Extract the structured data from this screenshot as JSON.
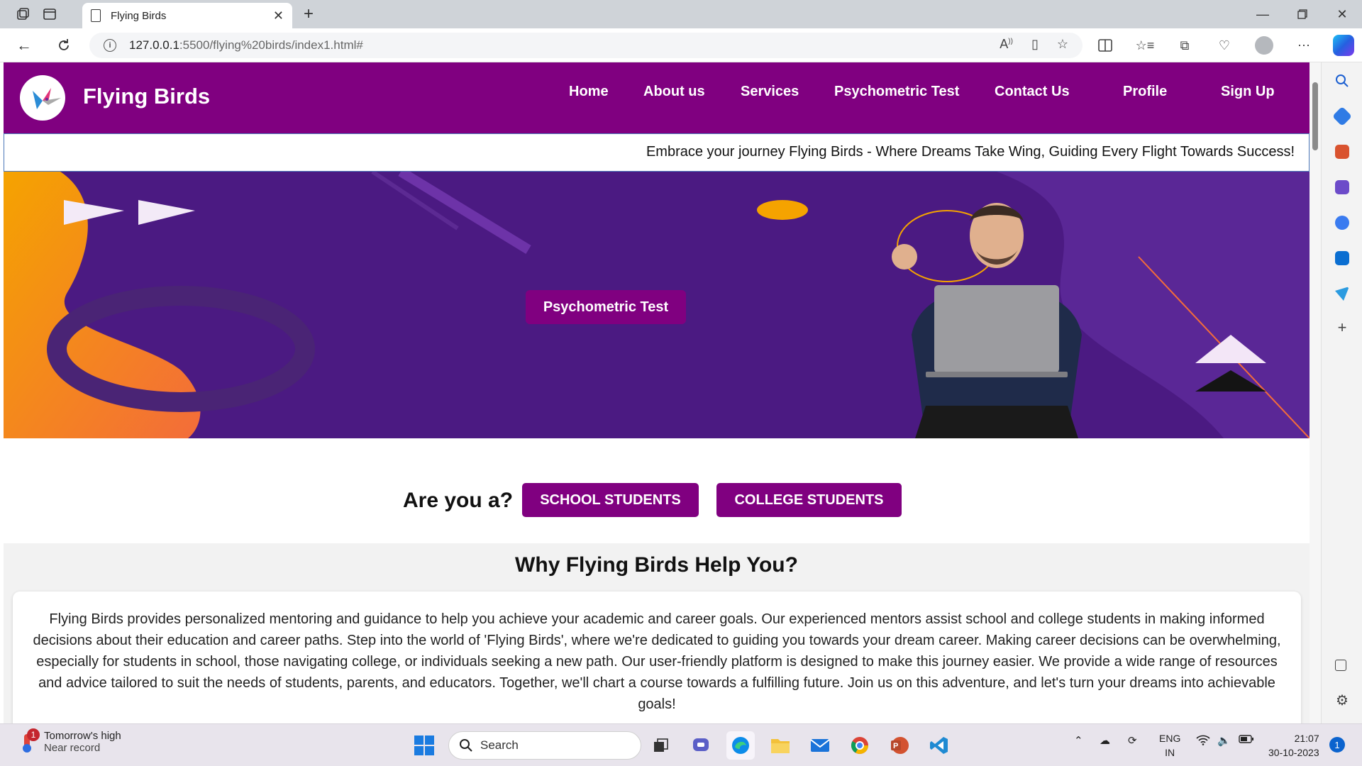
{
  "browser": {
    "tab_title": "Flying Birds",
    "new_tab_symbol": "+",
    "address_host": "127.0.0.1",
    "address_path": ":5500/flying%20birds/index1.html#"
  },
  "site": {
    "brand": "Flying Birds",
    "nav": [
      "Home",
      "About us",
      "Services",
      "Psychometric Test",
      "Contact Us",
      "Profile",
      "Sign Up"
    ],
    "marquee": "Embrace your journey Flying Birds - Where Dreams Take Wing, Guiding Every Flight Towards Success!",
    "hero_button": "Psychometric Test",
    "question": "Are you a?",
    "school_button": "SCHOOL STUDENTS",
    "college_button": "COLLEGE STUDENTS",
    "why_title": "Why Flying Birds Help You?",
    "why_text": "Flying Birds provides personalized mentoring and guidance to help you achieve your academic and career goals. Our experienced mentors assist school and college students in making informed decisions about their education and career paths. Step into the world of 'Flying Birds', where we're dedicated to guiding you towards your dream career. Making career decisions can be overwhelming, especially for students in school, those navigating college, or individuals seeking a new path. Our user-friendly platform is designed to make this journey easier. We provide a wide range of resources and advice tailored to suit the needs of students, parents, and educators. Together, we'll chart a course towards a fulfilling future. Join us on this adventure, and let's turn your dreams into achievable goals!",
    "colors": {
      "primary": "#800080",
      "hero_bg": "#4b1a82",
      "accent_orange": "#f5a300"
    }
  },
  "taskbar": {
    "weather_badge": "1",
    "weather_line1": "Tomorrow's high",
    "weather_line2": "Near record",
    "search_label": "Search",
    "language_line1": "ENG",
    "language_line2": "IN",
    "time": "21:07",
    "date": "30-10-2023",
    "notification_count": "1"
  }
}
